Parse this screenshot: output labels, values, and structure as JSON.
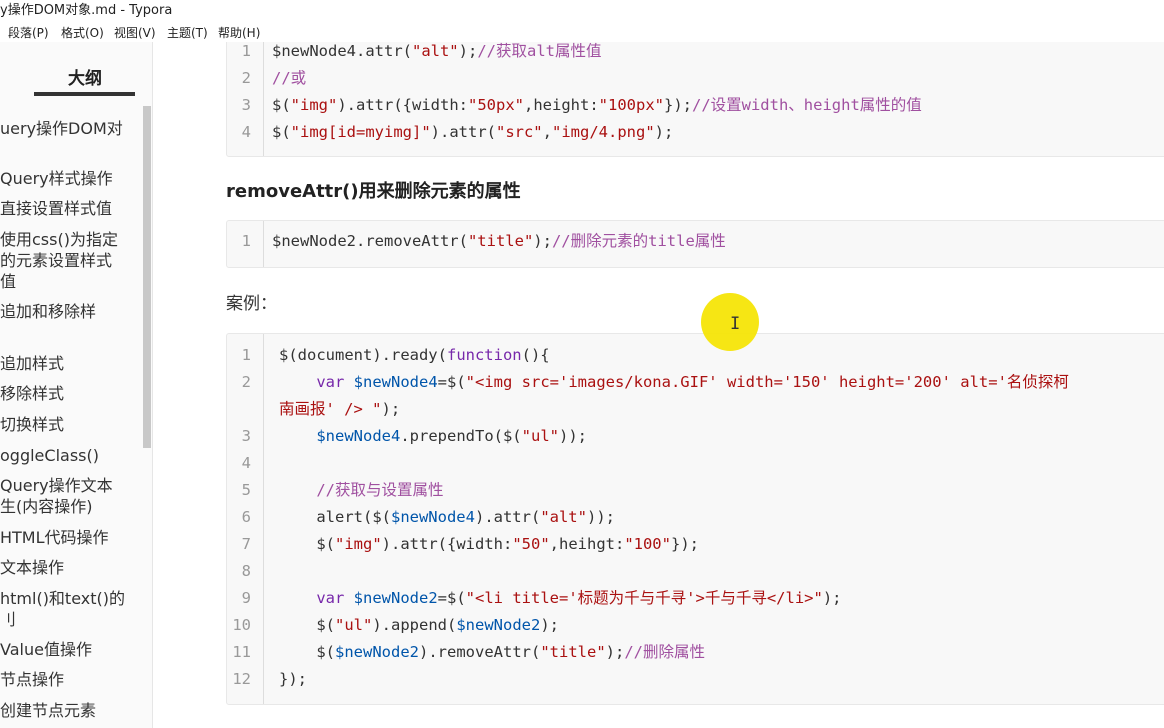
{
  "window": {
    "title": "y操作DOM对象.md - Typora"
  },
  "menu": [
    "段落(P)",
    "格式(O)",
    "视图(V)",
    "主题(T)",
    "帮助(H)"
  ],
  "sidebar": {
    "title": "大纲",
    "items": [
      "uery操作DOM对",
      "Query样式操作",
      "直接设置样式值",
      "使用css()为指定",
      "的元素设置样式",
      "值",
      "追加和移除样",
      "追加样式",
      "移除样式",
      "切换样式",
      "oggleClass()",
      "Query操作文本",
      "生(内容操作)",
      "HTML代码操作",
      "文本操作",
      "html()和text()的",
      "刂",
      "Value值操作",
      "节点操作",
      "创建节点元素"
    ]
  },
  "code_block_1": {
    "lines": [
      {
        "n": "1",
        "tokens": [
          [
            "$newNode4.attr(",
            "c-black"
          ],
          [
            "\"alt\"",
            "c-str"
          ],
          [
            ");",
            "c-black"
          ],
          [
            "//获取alt属性值",
            "c-cmt"
          ]
        ]
      },
      {
        "n": "2",
        "tokens": [
          [
            "//或",
            "c-cmt"
          ]
        ]
      },
      {
        "n": "3",
        "tokens": [
          [
            "$(",
            "c-black"
          ],
          [
            "\"img\"",
            "c-str"
          ],
          [
            ").attr({width:",
            "c-black"
          ],
          [
            "\"50px\"",
            "c-str"
          ],
          [
            ",height:",
            "c-black"
          ],
          [
            "\"100px\"",
            "c-str"
          ],
          [
            "});",
            "c-black"
          ],
          [
            "//设置width、height属性的值",
            "c-cmt"
          ]
        ]
      },
      {
        "n": "4",
        "tokens": [
          [
            "$(",
            "c-black"
          ],
          [
            "\"img[id=myimg]\"",
            "c-str"
          ],
          [
            ").attr(",
            "c-black"
          ],
          [
            "\"src\"",
            "c-str"
          ],
          [
            ",",
            "c-black"
          ],
          [
            "\"img/4.png\"",
            "c-str"
          ],
          [
            ");",
            "c-black"
          ]
        ]
      }
    ]
  },
  "heading_removeAttr": "removeAttr()用来删除元素的属性",
  "code_block_2": {
    "lines": [
      {
        "n": "1",
        "tokens": [
          [
            "$newNode2.removeAttr(",
            "c-black"
          ],
          [
            "\"title\"",
            "c-str"
          ],
          [
            ");",
            "c-black"
          ],
          [
            "//删除元素的title属性",
            "c-cmt"
          ]
        ]
      }
    ]
  },
  "para_example": "案例：",
  "code_block_3": {
    "lines": [
      {
        "n": "1",
        "tokens": [
          [
            "$(document).ready(",
            "c-black"
          ],
          [
            "function",
            "c-kw"
          ],
          [
            "(){",
            "c-black"
          ]
        ]
      },
      {
        "n": "2",
        "tokens": [
          [
            "    ",
            "c-black"
          ],
          [
            "var",
            "c-kw"
          ],
          [
            " ",
            "c-black"
          ],
          [
            "$newNode4",
            "c-var"
          ],
          [
            "=$(",
            "c-black"
          ],
          [
            "\"<img src='images/kona.GIF' width='150' height='200' alt='名侦探柯",
            "c-str"
          ]
        ]
      },
      {
        "n": "",
        "tokens": [
          [
            "南画报' /> \"",
            "c-str"
          ],
          [
            ");",
            "c-black"
          ]
        ]
      },
      {
        "n": "3",
        "tokens": [
          [
            "    ",
            "c-black"
          ],
          [
            "$newNode4",
            "c-var"
          ],
          [
            ".prependTo($(",
            "c-black"
          ],
          [
            "\"ul\"",
            "c-str"
          ],
          [
            "));",
            "c-black"
          ]
        ]
      },
      {
        "n": "4",
        "tokens": []
      },
      {
        "n": "5",
        "tokens": [
          [
            "    ",
            "c-black"
          ],
          [
            "//获取与设置属性",
            "c-cmt"
          ]
        ]
      },
      {
        "n": "6",
        "tokens": [
          [
            "    alert($(",
            "c-black"
          ],
          [
            "$newNode4",
            "c-var"
          ],
          [
            ").attr(",
            "c-black"
          ],
          [
            "\"alt\"",
            "c-str"
          ],
          [
            "));",
            "c-black"
          ]
        ]
      },
      {
        "n": "7",
        "tokens": [
          [
            "    $(",
            "c-black"
          ],
          [
            "\"img\"",
            "c-str"
          ],
          [
            ").attr({width:",
            "c-black"
          ],
          [
            "\"50\"",
            "c-str"
          ],
          [
            ",heihgt:",
            "c-black"
          ],
          [
            "\"100\"",
            "c-str"
          ],
          [
            "});",
            "c-black"
          ]
        ]
      },
      {
        "n": "8",
        "tokens": []
      },
      {
        "n": "9",
        "tokens": [
          [
            "    ",
            "c-black"
          ],
          [
            "var",
            "c-kw"
          ],
          [
            " ",
            "c-black"
          ],
          [
            "$newNode2",
            "c-var"
          ],
          [
            "=$(",
            "c-black"
          ],
          [
            "\"<li title='标题为千与千寻'>千与千寻</li>\"",
            "c-str"
          ],
          [
            ");",
            "c-black"
          ]
        ]
      },
      {
        "n": "10",
        "tokens": [
          [
            "    $(",
            "c-black"
          ],
          [
            "\"ul\"",
            "c-str"
          ],
          [
            ").append(",
            "c-black"
          ],
          [
            "$newNode2",
            "c-var"
          ],
          [
            ");",
            "c-black"
          ]
        ]
      },
      {
        "n": "11",
        "tokens": [
          [
            "    $(",
            "c-black"
          ],
          [
            "$newNode2",
            "c-var"
          ],
          [
            ").removeAttr(",
            "c-black"
          ],
          [
            "\"title\"",
            "c-str"
          ],
          [
            ");",
            "c-black"
          ],
          [
            "//删除属性",
            "c-cmt"
          ]
        ]
      },
      {
        "n": "12",
        "tokens": [
          [
            "});",
            "c-black"
          ]
        ]
      }
    ]
  },
  "colors": {
    "string": "#a11111",
    "comment": "#a050a0",
    "keyword": "#7728aa",
    "variable": "#0055aa",
    "highlight": "#f5e400"
  }
}
